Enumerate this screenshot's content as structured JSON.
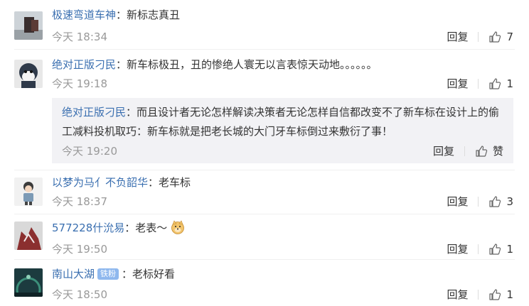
{
  "comments": [
    {
      "user": "极速弯道车神",
      "text": "新标志真丑",
      "time": "今天 18:34",
      "reply": "回复",
      "likes": "7"
    },
    {
      "user": "绝对正版刁民",
      "text": "新车标极丑，丑的惨绝人寰无以言表惊天动地。。。。。。",
      "time": "今天 19:18",
      "reply": "回复",
      "likes": "1",
      "sub": {
        "user": "绝对正版刁民",
        "text": "而且设计者无论怎样解读决策者无论怎样自信都改变不了新车标在设计上的偷工减料投机取巧：新车标就是把老长城的大门牙车标倒过来敷衍了事！",
        "time": "今天 19:20",
        "reply": "回复",
        "likes": "赞"
      }
    },
    {
      "user": "以梦为马亻不负韶华",
      "text": "老车标",
      "time": "今天 18:37",
      "reply": "回复",
      "likes": "3"
    },
    {
      "user": "577228什沇易",
      "text": "老表～",
      "time": "今天 19:50",
      "reply": "回复",
      "likes": "1"
    },
    {
      "user": "南山大湖",
      "badge": "铁粉",
      "text": "老标好看",
      "time": "今天 18:50",
      "reply": "回复",
      "likes": "1"
    }
  ],
  "colors": {
    "username": "#3a6fb0",
    "meta": "#999999",
    "badge": "#8fb8ee",
    "subbox": "#f2f2f5"
  }
}
